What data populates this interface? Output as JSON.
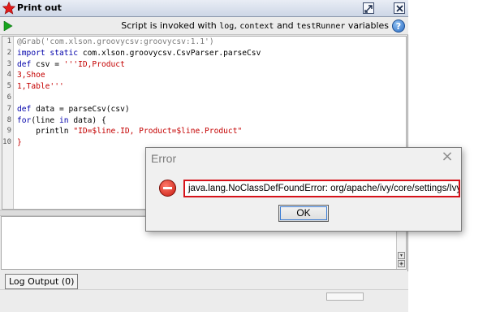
{
  "window": {
    "title": "Print out",
    "buttons": [
      "restore",
      "close"
    ]
  },
  "toolbar": {
    "info_prefix": "Script is invoked with ",
    "var_log": "log",
    "sep1": ", ",
    "var_context": "context",
    "sep2": " and ",
    "var_runner": "testRunner",
    "info_suffix": " variables",
    "help_label": "?"
  },
  "editor": {
    "line_numbers": [
      "1",
      "2",
      "3",
      "4",
      "5",
      "6",
      "7",
      "8",
      "9",
      "10"
    ],
    "lines": [
      [
        {
          "t": "@Grab('com.xlson.groovycsv:groovycsv:1.1')",
          "c": "a"
        }
      ],
      [
        {
          "t": "import static",
          "c": "k"
        },
        {
          "t": " com.xlson.groovycsv.CsvParser.parseCsv",
          "c": ""
        }
      ],
      [
        {
          "t": "def",
          "c": "k"
        },
        {
          "t": " csv = ",
          "c": ""
        },
        {
          "t": "'''ID,Product",
          "c": "s"
        }
      ],
      [
        {
          "t": "3,Shoe",
          "c": "s"
        }
      ],
      [
        {
          "t": "1,Table'''",
          "c": "s"
        }
      ],
      [
        {
          "t": "",
          "c": ""
        }
      ],
      [
        {
          "t": "def",
          "c": "k"
        },
        {
          "t": " data = parseCsv(csv)",
          "c": ""
        }
      ],
      [
        {
          "t": "for",
          "c": "k"
        },
        {
          "t": "(line ",
          "c": ""
        },
        {
          "t": "in",
          "c": "k"
        },
        {
          "t": " data) {",
          "c": ""
        }
      ],
      [
        {
          "t": "    println ",
          "c": ""
        },
        {
          "t": "\"ID=$line.ID, Product=$line.Product\"",
          "c": "s"
        }
      ],
      [
        {
          "t": "}",
          "c": "s"
        }
      ]
    ]
  },
  "tabs": {
    "log_output": "Log Output (0)"
  },
  "dialog": {
    "title": "Error",
    "close_glyph": "×",
    "message": "java.lang.NoClassDefFoundError: org/apache/ivy/core/settings/IvySettings",
    "ok_label": "OK"
  },
  "icons": {
    "window": "star-icon",
    "run": "play-icon",
    "help": "help-icon",
    "error": "error-icon"
  },
  "colors": {
    "keyword": "#0000aa",
    "string": "#c40000",
    "annotation": "#7a7a7a",
    "error_border": "#d6121a"
  }
}
